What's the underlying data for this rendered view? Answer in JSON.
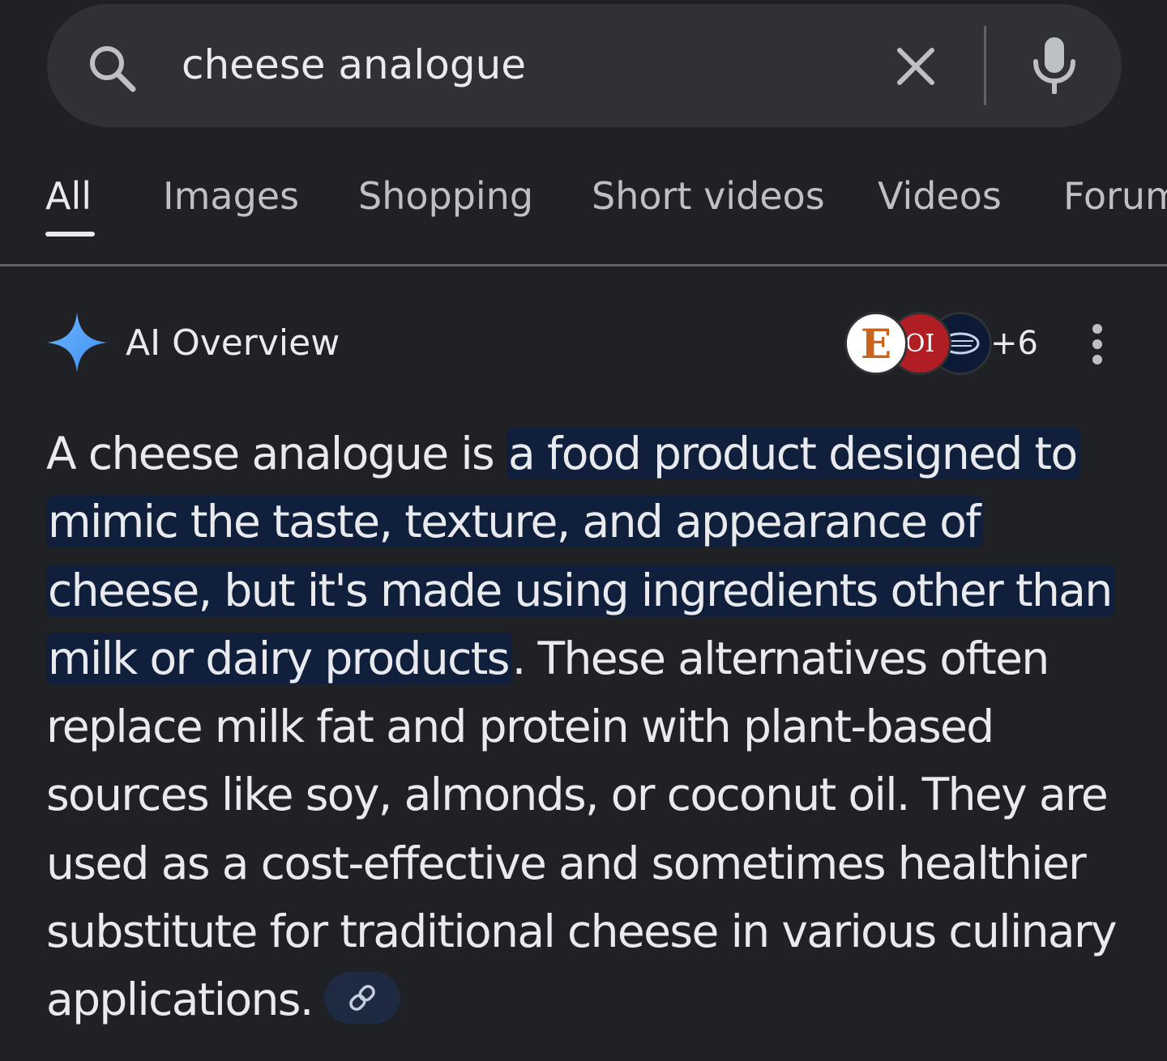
{
  "search": {
    "query": "cheese analogue"
  },
  "tabs": [
    {
      "label": "All",
      "active": true
    },
    {
      "label": "Images",
      "active": false
    },
    {
      "label": "Shopping",
      "active": false
    },
    {
      "label": "Short videos",
      "active": false
    },
    {
      "label": "Videos",
      "active": false
    },
    {
      "label": "Forum",
      "active": false
    }
  ],
  "ai_overview": {
    "title": "AI Overview",
    "sources": {
      "avatars": [
        {
          "icon": "source-logo-e",
          "text": "E"
        },
        {
          "icon": "source-logo-oi",
          "text": "OI"
        },
        {
          "icon": "source-logo-badge",
          "text": ""
        }
      ],
      "more_count": "+6"
    },
    "answer": {
      "intro": "A cheese analogue is ",
      "highlight": "a food product designed to mimic the taste, texture, and appearance of cheese, but it's made using ingredients other than milk or dairy products",
      "rest": ". These alternatives often replace milk fat and protein with plant-based sources like soy, almonds, or coconut oil. They are used as a cost-effective and sometimes healthier substitute for traditional cheese in various culinary applications."
    },
    "link_icon": "link-icon"
  },
  "colors": {
    "background": "#202124",
    "search_bar": "#303134",
    "text": "#e8eaed",
    "muted_text": "#bdc1c6",
    "highlight_bg": "#10203c",
    "sparkle": "#4da3ff"
  }
}
